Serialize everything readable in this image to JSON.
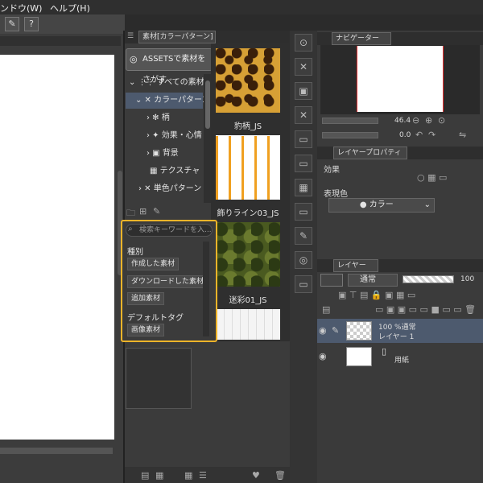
{
  "menubar": {
    "items": [
      "ンドウ(W)",
      "ヘルプ(H)"
    ]
  },
  "material_panel": {
    "tab_label": "素材[カラーパターン]",
    "assets_button": "ASSETSで素材をさがす",
    "tree": [
      "すべての素材",
      "カラーパターン",
      "柄",
      "効果・心情",
      "背景",
      "テクスチャ",
      "単色パターン"
    ],
    "thumbnails": [
      {
        "label": "豹柄_JS"
      },
      {
        "label": "飾りライン03_JS"
      },
      {
        "label": "迷彩01_JS"
      }
    ],
    "search": {
      "placeholder": "検索キーワードを入...",
      "type_label": "種別",
      "type_options": [
        "作成した素材",
        "ダウンロードした素材",
        "追加素材"
      ],
      "tag_label": "デフォルトタグ",
      "tag_options": [
        "画像素材"
      ]
    }
  },
  "navigator": {
    "tab_label": "ナビゲーター",
    "zoom": "46.4",
    "rotation": "0.0"
  },
  "layer_property": {
    "tab_label": "レイヤープロパティ",
    "effect_label": "効果",
    "color_label": "表現色",
    "color_value": "カラー"
  },
  "layers": {
    "tab_label": "レイヤー",
    "blend_mode": "通常",
    "opacity": "100",
    "items": [
      {
        "line1": "100 %通常",
        "line2": "レイヤー 1"
      },
      {
        "line1": "",
        "line2": "用紙"
      }
    ]
  },
  "colors": {
    "highlight": "#f0b429",
    "selection": "#4d5a6e",
    "nav_border": "#ee3333"
  }
}
